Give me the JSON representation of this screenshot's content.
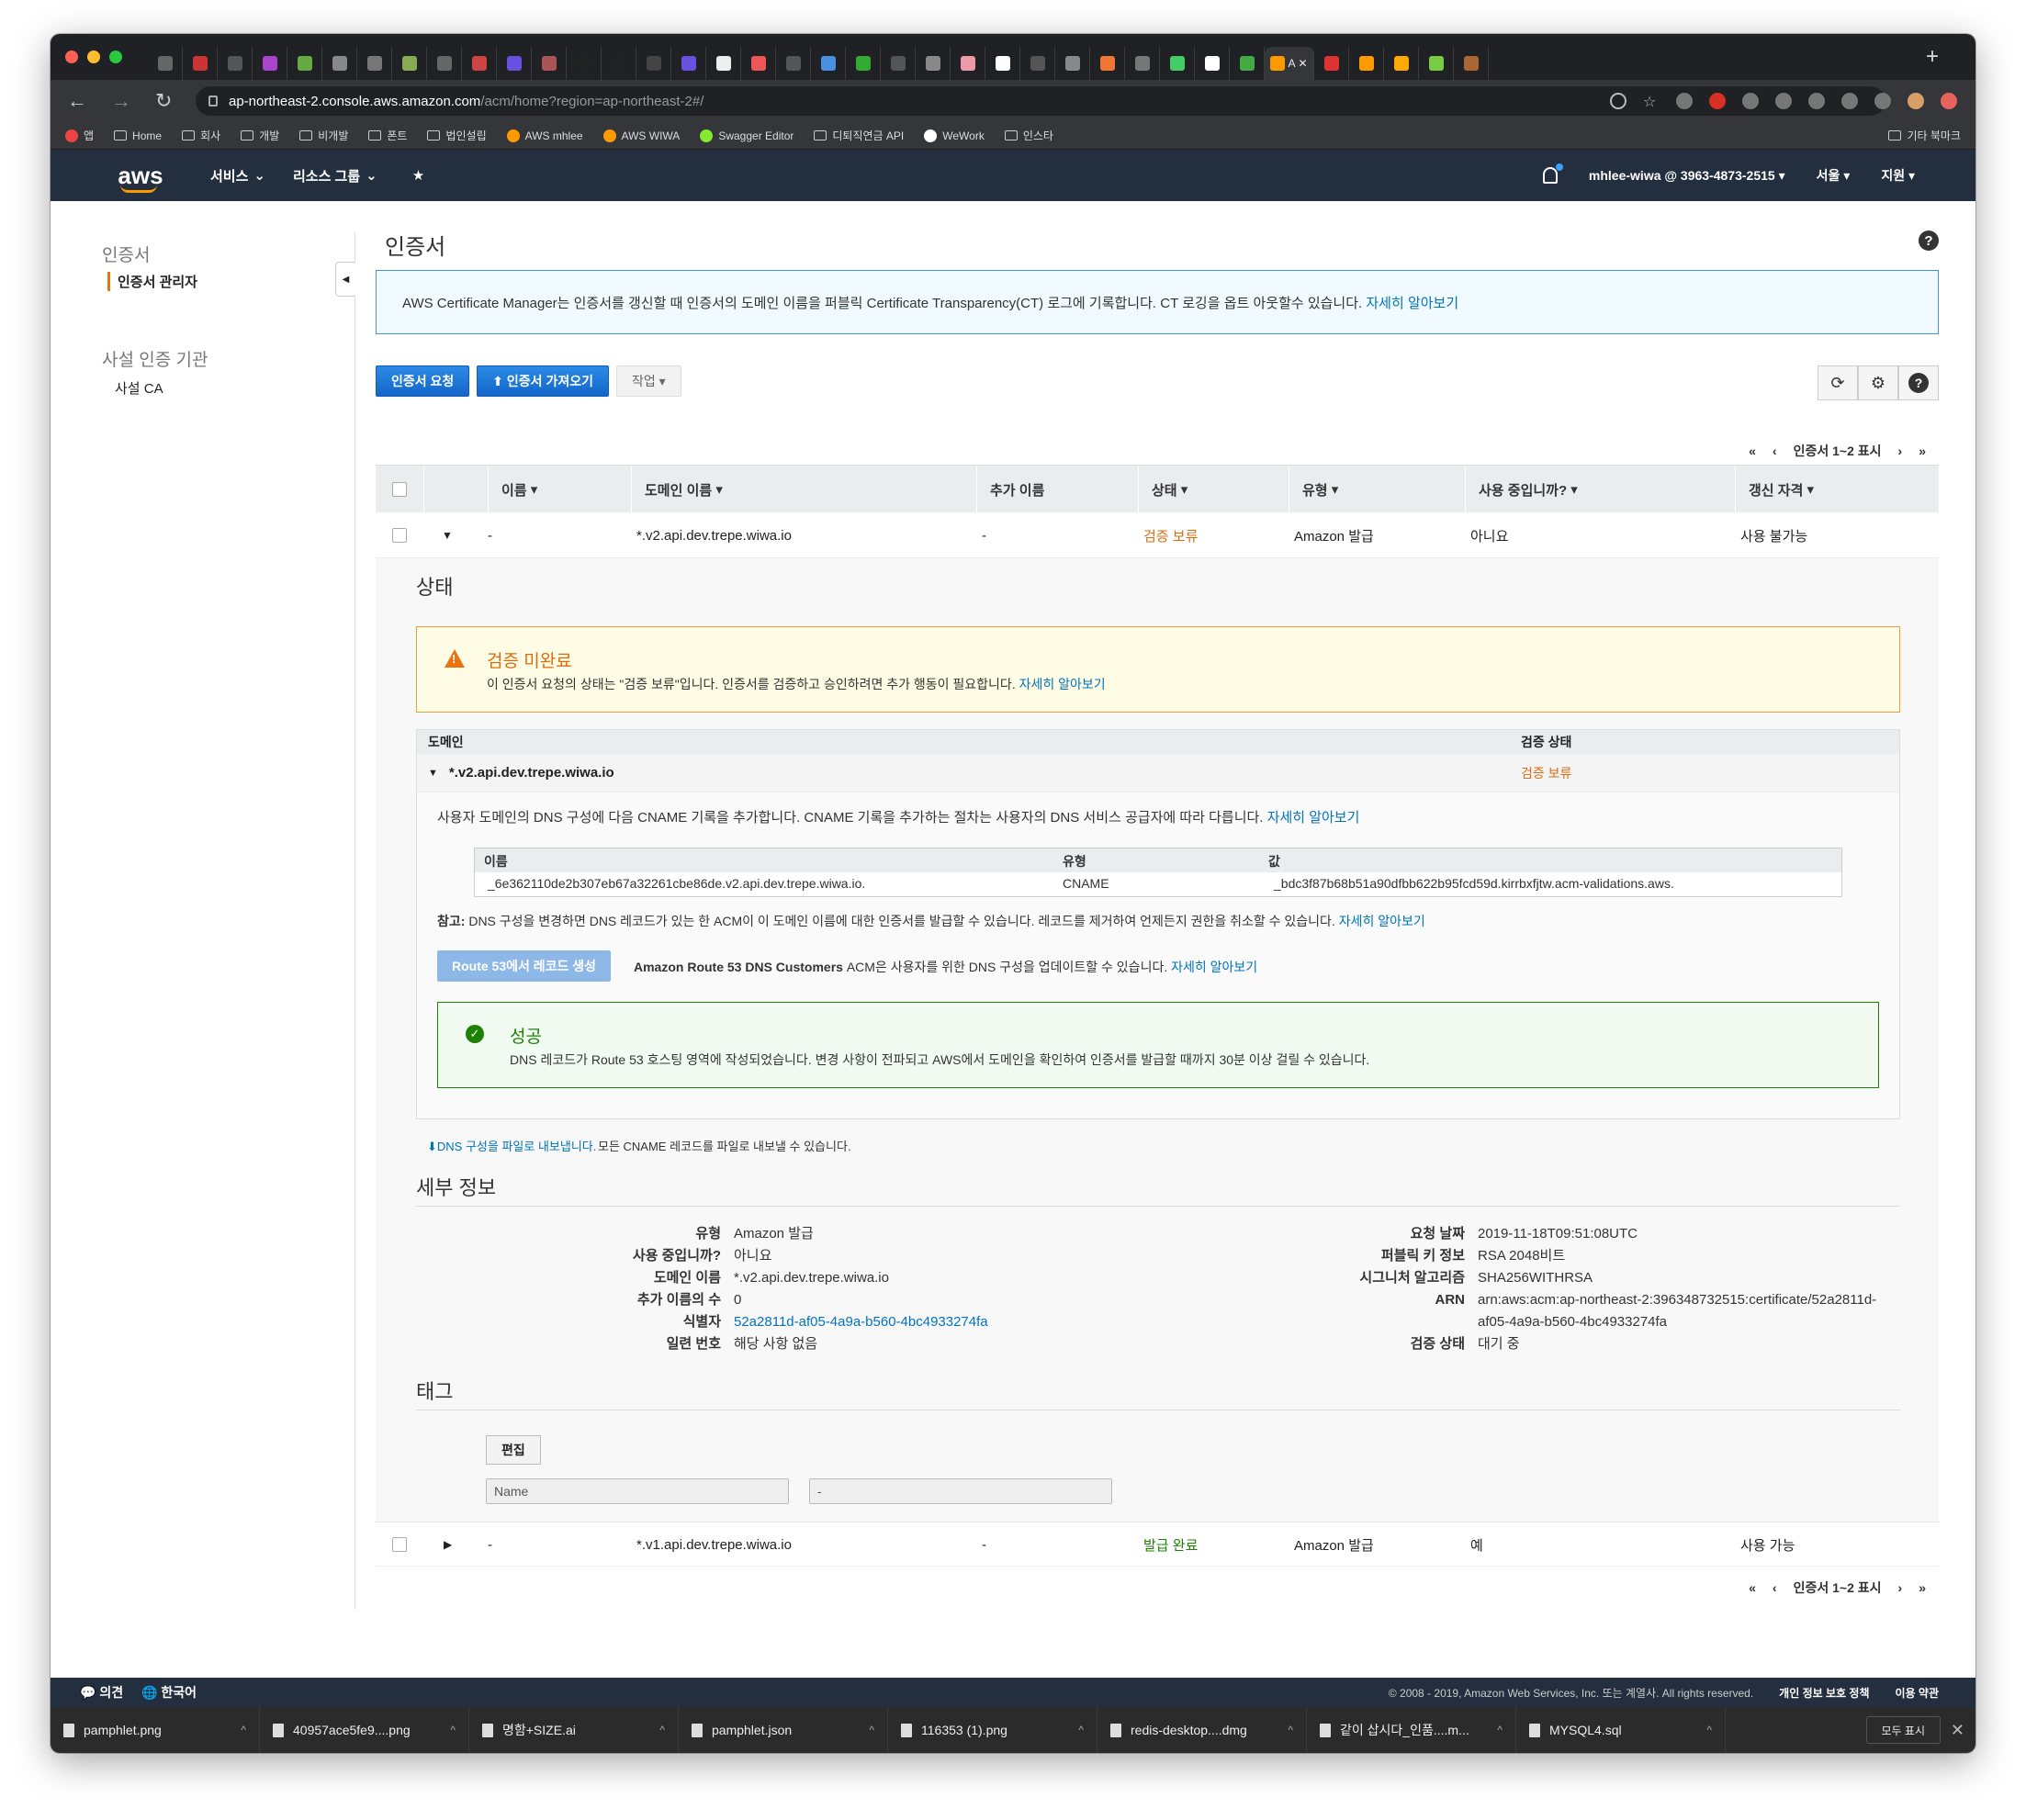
{
  "browser": {
    "active_tab": "A",
    "url_host": "ap-northeast-2.console.aws.amazon.com",
    "url_path": "/acm/home?region=ap-northeast-2#/",
    "bookmarks": [
      "앱",
      "Home",
      "회사",
      "개발",
      "비개발",
      "폰트",
      "법인설립",
      "AWS mhlee",
      "AWS WIWA",
      "Swagger Editor",
      "디퇴직연금 API",
      "WeWork",
      "인스타"
    ],
    "bookmarks_other": "기타 북마크"
  },
  "aws_nav": {
    "logo": "aws",
    "services": "서비스",
    "resource_groups": "리소스 그룹",
    "account": "mhlee-wiwa @ 3963-4873-2515",
    "region": "서울",
    "support": "지원"
  },
  "sidebar": {
    "section1": "인증서",
    "item1": "인증서 관리자",
    "section2": "사설 인증 기관",
    "item2": "사설 CA"
  },
  "page": {
    "title": "인증서",
    "info_text": "AWS Certificate Manager는 인증서를 갱신할 때 인증서의 도메인 이름을 퍼블릭 Certificate Transparency(CT) 로그에 기록합니다. CT 로깅을 옵트 아웃할수 있습니다.",
    "learn_more": "자세히 알아보기",
    "btn_request": "인증서 요청",
    "btn_import": "인증서 가져오기",
    "btn_actions": "작업",
    "pager": "인증서 1~2 표시"
  },
  "table": {
    "headers": [
      "이름",
      "도메인 이름",
      "추가 이름",
      "상태",
      "유형",
      "사용 중입니까?",
      "갱신 자격"
    ],
    "rows": [
      {
        "name": "-",
        "domain": "*.v2.api.dev.trepe.wiwa.io",
        "extra": "-",
        "status": "검증 보류",
        "type": "Amazon 발급",
        "in_use": "아니요",
        "renewal": "사용 불가능"
      },
      {
        "name": "-",
        "domain": "*.v1.api.dev.trepe.wiwa.io",
        "extra": "-",
        "status": "발급 완료",
        "type": "Amazon 발급",
        "in_use": "예",
        "renewal": "사용 가능"
      }
    ]
  },
  "detail": {
    "status_title": "상태",
    "warn_title": "검증 미완료",
    "warn_text": "이 인증서 요청의 상태는 \"검증 보류\"입니다. 인증서를 검증하고 승인하려면 추가 행동이 필요합니다.",
    "dom_header": "도메인",
    "dom_status_header": "검증 상태",
    "dom_name": "*.v2.api.dev.trepe.wiwa.io",
    "dom_status": "검증 보류",
    "dns_text": "사용자 도메인의 DNS 구성에 다음 CNAME 기록을 추가합니다. CNAME 기록을 추가하는 절차는 사용자의 DNS 서비스 공급자에 따라 다릅니다.",
    "cname_h_name": "이름",
    "cname_h_type": "유형",
    "cname_h_value": "값",
    "cname_name": "_6e362110de2b307eb67a32261cbe86de.v2.api.dev.trepe.wiwa.io.",
    "cname_type": "CNAME",
    "cname_value": "_bdc3f87b68b51a90dfbb622b95fcd59d.kirrbxfjtw.acm-validations.aws.",
    "note_label": "참고:",
    "note_text": "DNS 구성을 변경하면 DNS 레코드가 있는 한 ACM이 이 도메인 이름에 대한 인증서를 발급할 수 있습니다. 레코드를 제거하여 언제든지 권한을 취소할 수 있습니다.",
    "r53_button": "Route 53에서 레코드 생성",
    "r53_label": "Amazon Route 53 DNS Customers",
    "r53_text": "ACM은 사용자를 위한 DNS 구성을 업데이트할 수 있습니다.",
    "success_title": "성공",
    "success_text": "DNS 레코드가 Route 53 호스팅 영역에 작성되었습니다. 변경 사항이 전파되고 AWS에서 도메인을 확인하여 인증서를 발급할 때까지 30분 이상 걸릴 수 있습니다.",
    "export_link": "DNS 구성을 파일로 내보냅니다.",
    "export_text": "모든 CNAME 레코드를 파일로 내보낼 수 있습니다.",
    "details_title": "세부 정보",
    "left_keys": [
      "유형",
      "사용 중입니까?",
      "도메인 이름",
      "추가 이름의 수",
      "식별자",
      "일련 번호"
    ],
    "left_vals": [
      "Amazon 발급",
      "아니요",
      "*.v2.api.dev.trepe.wiwa.io",
      "0",
      "52a2811d-af05-4a9a-b560-4bc4933274fa",
      "해당 사항 없음"
    ],
    "right_keys": [
      "요청 날짜",
      "퍼블릭 키 정보",
      "시그니처 알고리즘",
      "ARN",
      "",
      "검증 상태"
    ],
    "right_vals": [
      "2019-11-18T09:51:08UTC",
      "RSA 2048비트",
      "SHA256WITHRSA",
      "arn:aws:acm:ap-northeast-2:396348732515:certificate/52a2811d-",
      "af05-4a9a-b560-4bc4933274fa",
      "대기 중"
    ],
    "tags_title": "태그",
    "tags_edit": "편집",
    "tag_key": "Name",
    "tag_value": "-"
  },
  "footer": {
    "feedback": "의견",
    "language": "한국어",
    "copyright": "© 2008 - 2019, Amazon Web Services, Inc. 또는 계열사. All rights reserved.",
    "privacy": "개인 정보 보호 정책",
    "terms": "이용 약관"
  },
  "downloads": {
    "files": [
      "MYSQL4.sql",
      "같이 삽시다_인품....m...",
      "redis-desktop....dmg",
      "116353 (1).png",
      "pamphlet.json",
      "명함+SIZE.ai",
      "40957ace5fe9....png",
      "pamphlet.png"
    ],
    "show_all": "모두 표시"
  }
}
